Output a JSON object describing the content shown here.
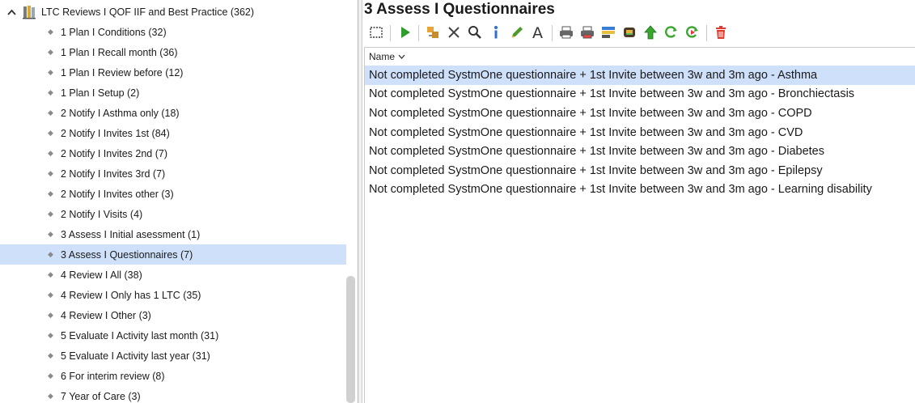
{
  "tree": {
    "root_label": "LTC Reviews I QOF IIF and Best Practice (362)",
    "items": [
      {
        "label": "1 Plan I Conditions (32)"
      },
      {
        "label": "1 Plan I Recall month (36)"
      },
      {
        "label": "1 Plan I Review before (12)"
      },
      {
        "label": "1 Plan I Setup (2)"
      },
      {
        "label": "2 Notify I Asthma only (18)"
      },
      {
        "label": "2 Notify I Invites 1st (84)"
      },
      {
        "label": "2 Notify I Invites 2nd (7)"
      },
      {
        "label": "2 Notify I Invites 3rd (7)"
      },
      {
        "label": "2 Notify I Invites other (3)"
      },
      {
        "label": "2 Notify I Visits (4)"
      },
      {
        "label": "3 Assess I Initial asessment (1)"
      },
      {
        "label": "3 Assess I Questionnaires (7)",
        "selected": true
      },
      {
        "label": "4 Review I All (38)"
      },
      {
        "label": "4 Review I Only has 1 LTC (35)"
      },
      {
        "label": "4 Review I Other (3)"
      },
      {
        "label": "5 Evaluate I Activity last month (31)"
      },
      {
        "label": "5 Evaluate I Activity last year (31)"
      },
      {
        "label": "6 For interim review (8)"
      },
      {
        "label": "7 Year of Care (3)"
      }
    ]
  },
  "panel": {
    "title": "3 Assess I Questionnaires",
    "toolbar": [
      {
        "icon": "select-all-icon"
      },
      {
        "icon": "run-icon"
      },
      {
        "icon": "move-icon"
      },
      {
        "icon": "delete-x-icon"
      },
      {
        "icon": "search-icon"
      },
      {
        "icon": "info-icon"
      },
      {
        "icon": "edit-pen-icon"
      },
      {
        "icon": "font-icon"
      },
      {
        "icon": "print-icon"
      },
      {
        "icon": "print-color-icon"
      },
      {
        "icon": "report-icon"
      },
      {
        "icon": "export-icon"
      },
      {
        "icon": "upload-arrow-icon"
      },
      {
        "icon": "refresh-icon"
      },
      {
        "icon": "refresh-run-icon"
      },
      {
        "icon": "trash-icon"
      }
    ],
    "column_header": "Name",
    "rows": [
      {
        "name": "Not completed SystmOne questionnaire + 1st Invite between 3w and 3m ago - Asthma",
        "selected": true
      },
      {
        "name": "Not completed SystmOne questionnaire + 1st Invite between 3w and 3m ago - Bronchiectasis"
      },
      {
        "name": "Not completed SystmOne questionnaire + 1st Invite between 3w and 3m ago - COPD"
      },
      {
        "name": "Not completed SystmOne questionnaire + 1st Invite between 3w and 3m ago - CVD"
      },
      {
        "name": "Not completed SystmOne questionnaire + 1st Invite between 3w and 3m ago - Diabetes"
      },
      {
        "name": "Not completed SystmOne questionnaire + 1st Invite between 3w and 3m ago - Epilepsy"
      },
      {
        "name": "Not completed SystmOne questionnaire + 1st Invite between 3w and 3m ago - Learning disability"
      }
    ]
  },
  "colors": {
    "selection": "#cfe0fb",
    "run_green": "#2e9d2e",
    "info_blue": "#2a6fd1",
    "trash_red": "#e03a2f"
  }
}
